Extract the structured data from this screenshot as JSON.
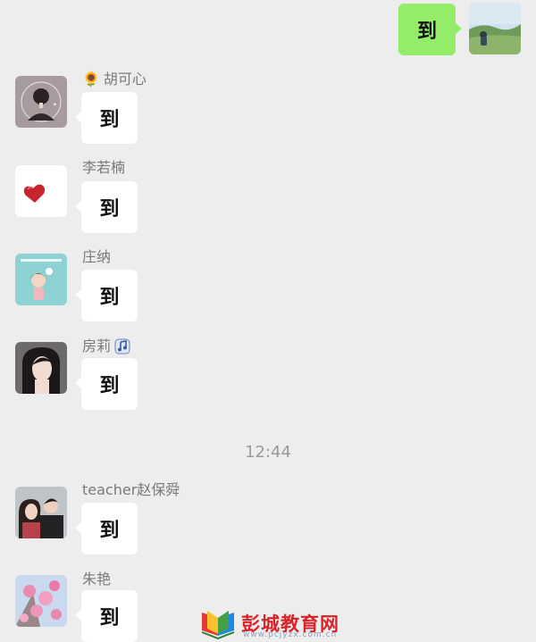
{
  "self_message": {
    "text": "到",
    "avatar_icon": "landscape-photo-avatar"
  },
  "messages": [
    {
      "sender_prefix": "🌻",
      "sender": "胡可心",
      "text": "到",
      "avatar_icon": "girl-portrait-avatar"
    },
    {
      "sender_prefix": "",
      "sender": "李若楠",
      "text": "到",
      "avatar_icon": "heart-avatar"
    },
    {
      "sender_prefix": "",
      "sender": "庄纳",
      "text": "到",
      "avatar_icon": "cartoon-girl-avatar"
    },
    {
      "sender_prefix": "",
      "sender": "房莉",
      "text": "到",
      "avatar_icon": "woman-photo-avatar",
      "sender_badge": "music-note-badge"
    },
    {
      "sender_prefix": "",
      "sender": "teacher赵保舜",
      "text": "到",
      "avatar_icon": "couple-photo-avatar"
    },
    {
      "sender_prefix": "",
      "sender": "朱艳",
      "text": "到",
      "avatar_icon": "pink-flowers-avatar"
    }
  ],
  "timestamp": "12:44",
  "watermark": {
    "title": "彭城教育网",
    "url": "www.pcjyzx.com.cn"
  },
  "colors": {
    "background": "#ededed",
    "outgoing_bubble": "#95ec69",
    "incoming_bubble": "#ffffff",
    "sender_text": "#7a7a7a",
    "watermark": "#d8232a"
  }
}
